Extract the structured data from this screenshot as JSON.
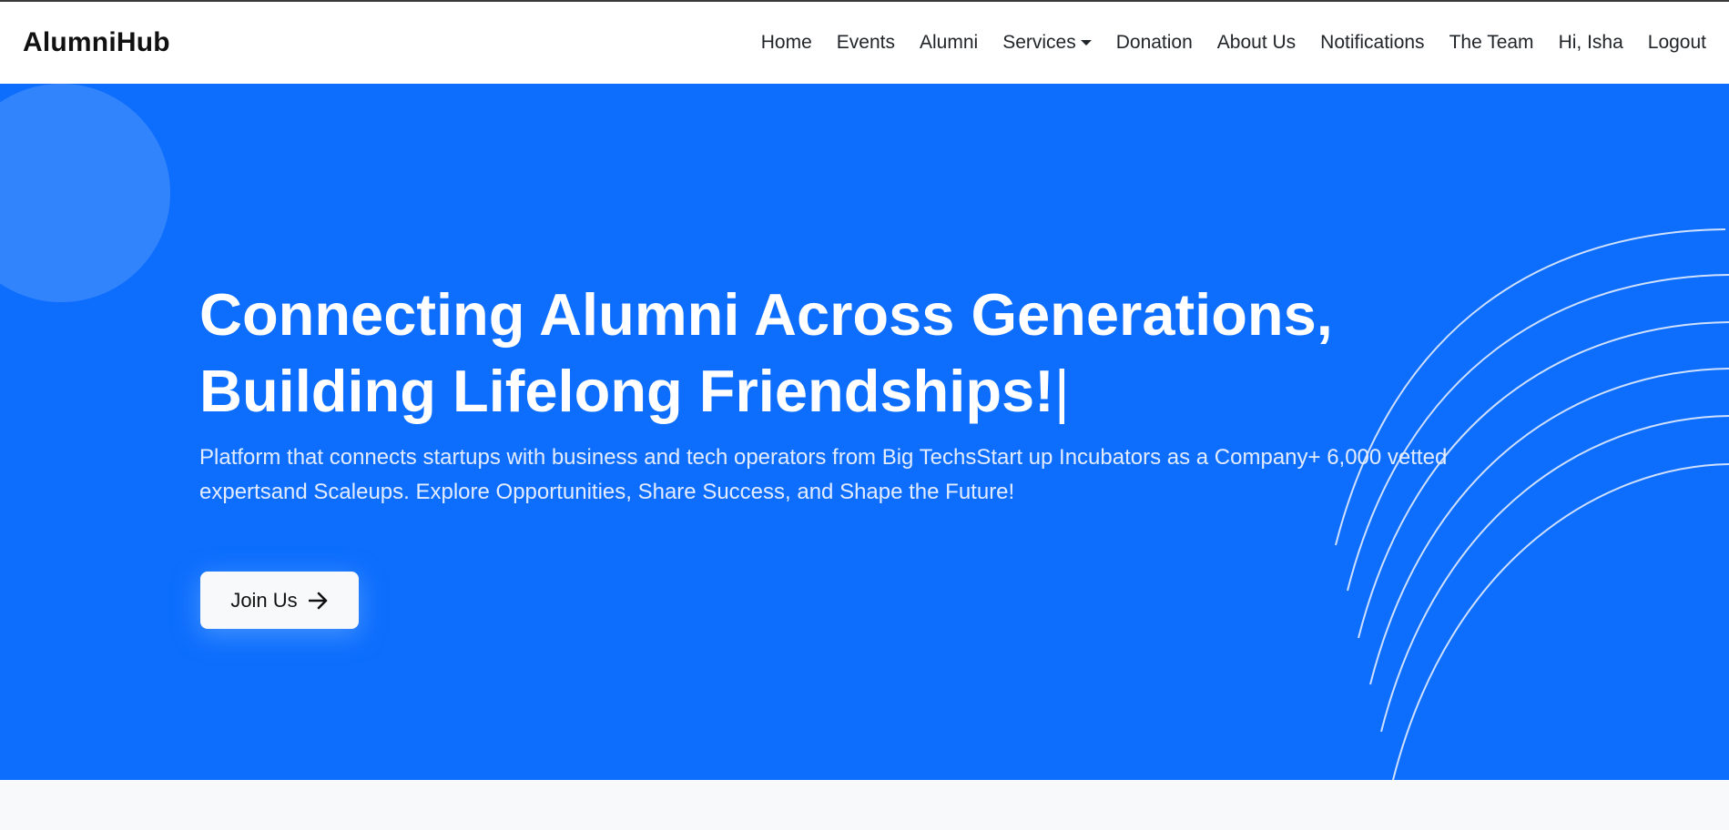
{
  "navbar": {
    "brand": "AlumniHub",
    "items": [
      {
        "label": "Home"
      },
      {
        "label": "Events"
      },
      {
        "label": "Alumni"
      },
      {
        "label": "Services",
        "dropdown": true
      },
      {
        "label": "Donation"
      },
      {
        "label": "About Us"
      },
      {
        "label": "Notifications"
      },
      {
        "label": "The Team"
      },
      {
        "label": "Hi, Isha"
      },
      {
        "label": "Logout"
      }
    ]
  },
  "hero": {
    "headline_line1": "Connecting Alumni Across Generations,",
    "headline_line2": "Building Lifelong Friendships!",
    "typing_cursor": "|",
    "subtext": "Platform that connects startups with business and tech operators from Big TechsStart up Incubators as a Company+ 6,000 vetted expertsand Scaleups. Explore Opportunities, Share Success, and Shape the Future!",
    "cta_label": "Join Us",
    "cta_icon": "arrow-right-icon"
  },
  "colors": {
    "hero_background": "#0d6efd",
    "navbar_background": "#ffffff",
    "page_background": "#f8f9fa",
    "cta_background": "#f8f9fa"
  }
}
